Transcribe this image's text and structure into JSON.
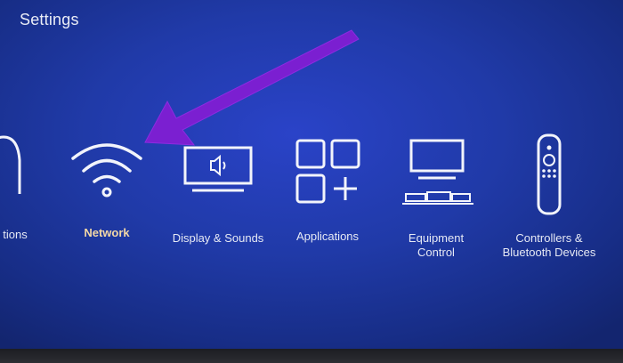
{
  "header": {
    "title": "Settings"
  },
  "menu": {
    "items": [
      {
        "label": "tions",
        "icon": "notifications-bell-icon"
      },
      {
        "label": "Network",
        "icon": "wifi-icon",
        "selected": true
      },
      {
        "label": "Display & Sounds",
        "icon": "display-sound-icon"
      },
      {
        "label": "Applications",
        "icon": "applications-grid-icon"
      },
      {
        "label_line1": "Equipment",
        "label_line2": "Control",
        "icon": "equipment-control-icon"
      },
      {
        "label_line1": "Controllers &",
        "label_line2": "Bluetooth Devices",
        "icon": "remote-control-icon"
      }
    ]
  },
  "colors": {
    "background": "#203aa8",
    "selected_label": "#f3d8a6",
    "annotation_arrow": "#7b1fd1"
  }
}
